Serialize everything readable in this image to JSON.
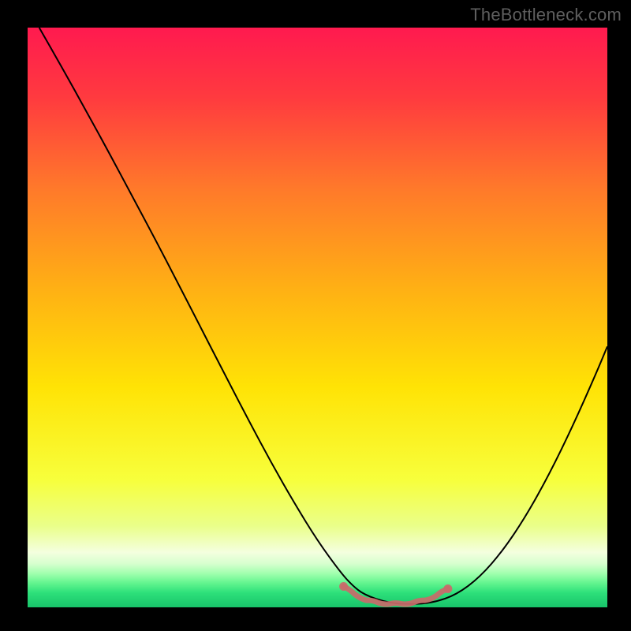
{
  "watermark": "TheBottleneck.com",
  "chart_data": {
    "type": "line",
    "title": "",
    "xlabel": "",
    "ylabel": "",
    "xlim": [
      0,
      1
    ],
    "ylim": [
      0,
      1
    ],
    "background_gradient": {
      "stops": [
        {
          "offset": 0.0,
          "color": "#ff1a4f"
        },
        {
          "offset": 0.12,
          "color": "#ff3a3f"
        },
        {
          "offset": 0.28,
          "color": "#ff7a2a"
        },
        {
          "offset": 0.45,
          "color": "#ffb014"
        },
        {
          "offset": 0.62,
          "color": "#ffe305"
        },
        {
          "offset": 0.78,
          "color": "#f7ff3c"
        },
        {
          "offset": 0.86,
          "color": "#eaff8a"
        },
        {
          "offset": 0.905,
          "color": "#f4ffdf"
        },
        {
          "offset": 0.925,
          "color": "#d6ffce"
        },
        {
          "offset": 0.942,
          "color": "#9fffad"
        },
        {
          "offset": 0.958,
          "color": "#63f58f"
        },
        {
          "offset": 0.975,
          "color": "#2de07a"
        },
        {
          "offset": 1.0,
          "color": "#18c46a"
        }
      ]
    },
    "series": [
      {
        "name": "bottleneck-curve",
        "color": "#000000",
        "width": 2,
        "x": [
          0.02,
          0.06,
          0.1,
          0.14,
          0.18,
          0.22,
          0.26,
          0.3,
          0.34,
          0.38,
          0.42,
          0.46,
          0.5,
          0.54,
          0.56,
          0.58,
          0.62,
          0.66,
          0.7,
          0.74,
          0.78,
          0.82,
          0.86,
          0.9,
          0.94,
          0.98,
          1.0
        ],
        "y": [
          1.0,
          0.93,
          0.858,
          0.785,
          0.71,
          0.635,
          0.558,
          0.48,
          0.402,
          0.325,
          0.25,
          0.18,
          0.115,
          0.06,
          0.038,
          0.022,
          0.008,
          0.005,
          0.008,
          0.022,
          0.052,
          0.098,
          0.158,
          0.23,
          0.312,
          0.402,
          0.45
        ]
      },
      {
        "name": "optimal-zone-markers",
        "type": "scatter",
        "color": "#c96a6a",
        "x": [
          0.545,
          0.565,
          0.585,
          0.605,
          0.625,
          0.645,
          0.665,
          0.685,
          0.705,
          0.725
        ],
        "y": [
          0.036,
          0.022,
          0.012,
          0.008,
          0.006,
          0.006,
          0.008,
          0.012,
          0.02,
          0.032
        ]
      }
    ]
  }
}
